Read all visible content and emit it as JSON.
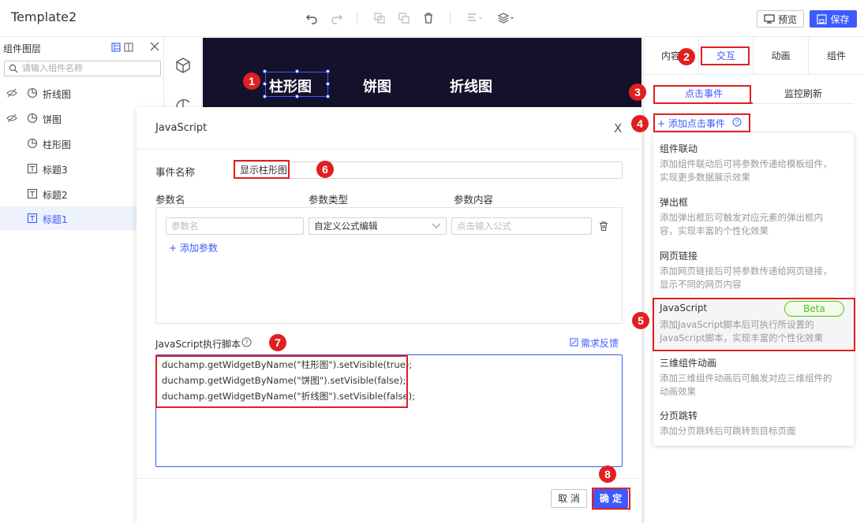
{
  "app_title": "Template2",
  "toolbar": {
    "icons": [
      "undo-icon",
      "redo-icon",
      "copy-icon",
      "paste-icon",
      "delete-icon",
      "align-icon",
      "layers-icon"
    ],
    "preview_label": "预览",
    "save_label": "保存"
  },
  "layers_panel": {
    "title": "组件图层",
    "search_placeholder": "请输入组件名称",
    "items": [
      {
        "label": "折线图",
        "icon": "pie-chart-icon",
        "hidden": true
      },
      {
        "label": "饼图",
        "icon": "pie-chart-icon",
        "hidden": true
      },
      {
        "label": "柱形图",
        "icon": "pie-chart-icon",
        "hidden": false
      },
      {
        "label": "标题3",
        "icon": "text-box-icon",
        "hidden": false
      },
      {
        "label": "标题2",
        "icon": "text-box-icon",
        "hidden": false
      },
      {
        "label": "标题1",
        "icon": "text-box-icon",
        "hidden": false,
        "active": true
      }
    ]
  },
  "canvas": {
    "texts": [
      "柱形图",
      "饼图",
      "折线图"
    ]
  },
  "right_panel": {
    "tabs": [
      "内容",
      "交互",
      "动画",
      "组件"
    ],
    "subtabs": [
      "点击事件",
      "监控刷新"
    ],
    "add_event_label": "添加点击事件",
    "menu": [
      {
        "title": "组件联动",
        "desc": "添加组件联动后可将参数传递给模板组件，实现更多数据展示效果"
      },
      {
        "title": "弹出框",
        "desc": "添加弹出框后可触发对应元素的弹出框内容，实现丰富的个性化效果"
      },
      {
        "title": "网页链接",
        "desc": "添加网页链接后可将参数传递给网页链接，显示不同的网页内容"
      },
      {
        "title": "JavaScript",
        "desc": "添加JavaScript脚本后可执行所设置的JavaScript脚本，实现丰富的个性化效果",
        "badge": "Beta"
      },
      {
        "title": "三维组件动画",
        "desc": "添加三维组件动画后可触发对应三维组件的动画效果"
      },
      {
        "title": "分页跳转",
        "desc": "添加分页跳转后可跳转到目标页面"
      }
    ]
  },
  "dialog": {
    "title": "JavaScript",
    "close": "X",
    "event_name_label": "事件名称",
    "event_name_value": "显示柱形图",
    "param_headers": [
      "参数名",
      "参数类型",
      "参数内容"
    ],
    "param_name_placeholder": "参数名",
    "param_type_value": "自定义公式编辑",
    "param_content_placeholder": "点击输入公式",
    "add_param_label": "添加参数",
    "script_label": "JavaScript执行脚本",
    "feedback_label": "需求反馈",
    "code_lines": [
      "duchamp.getWidgetByName(\"柱形图\").setVisible(true);",
      "duchamp.getWidgetByName(\"饼图\").setVisible(false);",
      "duchamp.getWidgetByName(\"折线图\").setVisible(false);"
    ],
    "cancel_label": "取 消",
    "ok_label": "确 定"
  },
  "markers": [
    "1",
    "2",
    "3",
    "4",
    "5",
    "6",
    "7",
    "8"
  ],
  "colors": {
    "accent": "#3d5afe",
    "marker_red": "#e02020",
    "canvas_bg": "#14122b",
    "beta_green": "#52c41a"
  }
}
